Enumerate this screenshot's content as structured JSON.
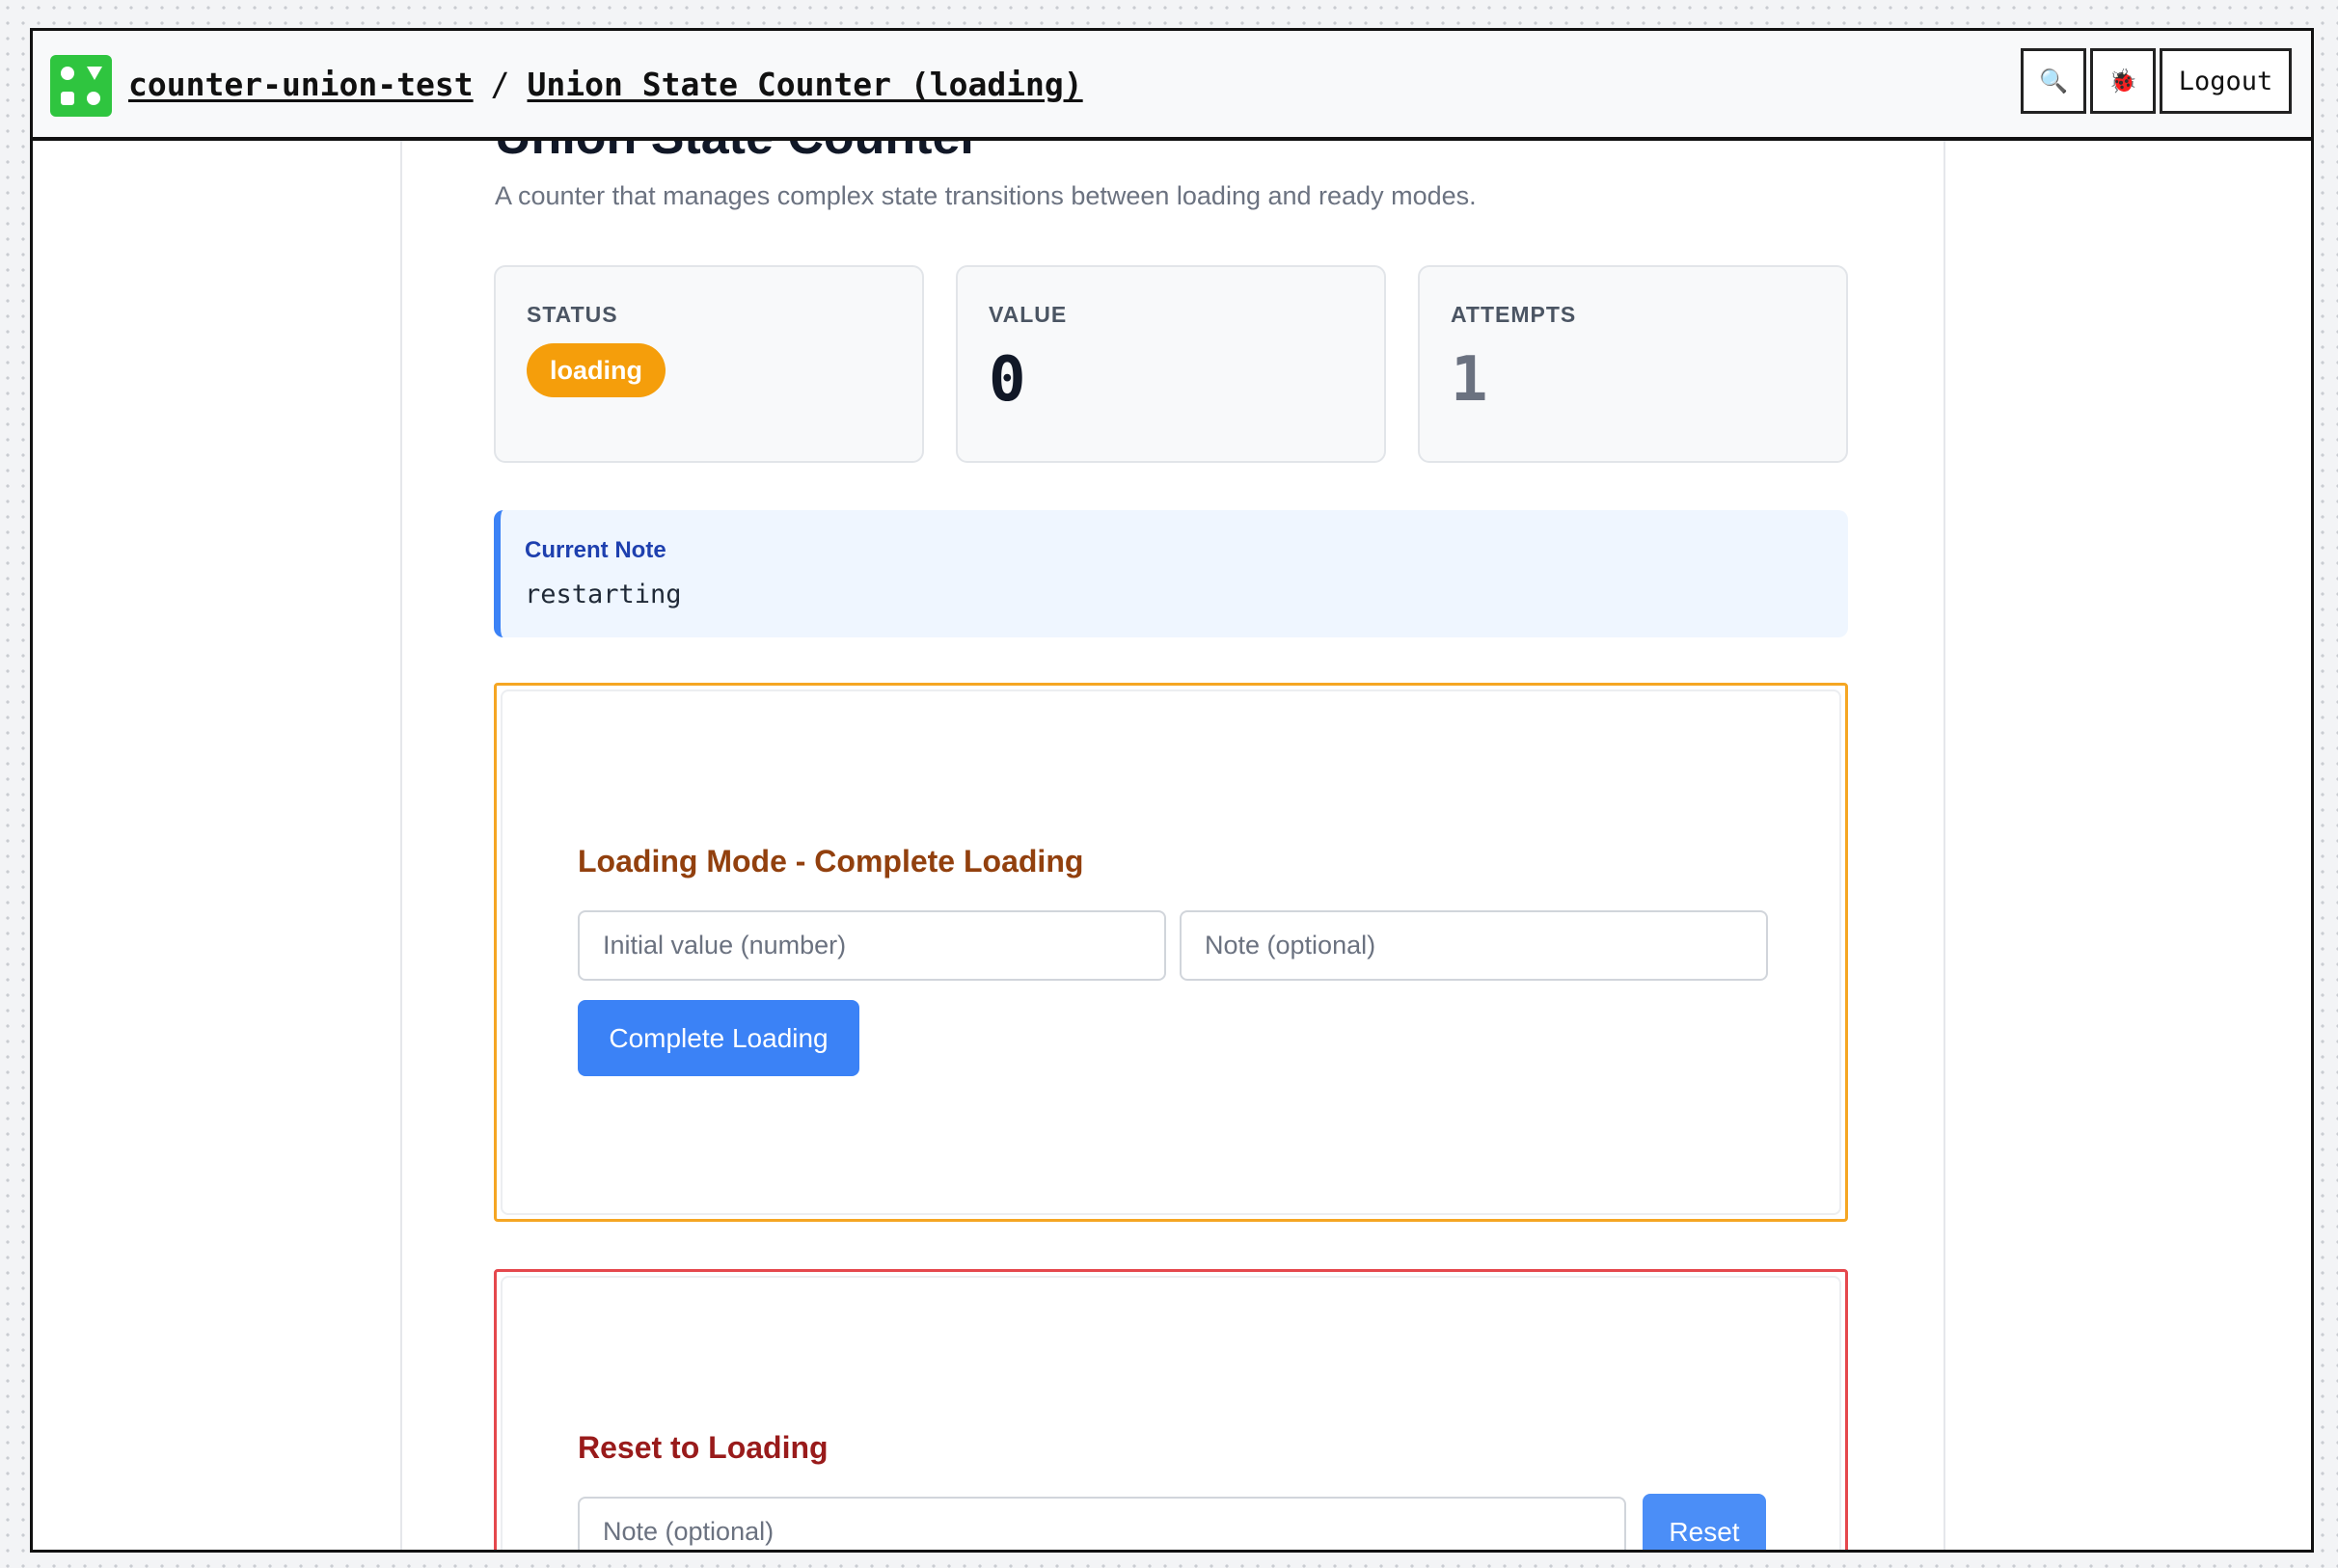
{
  "header": {
    "project": "counter-union-test",
    "separator": "/",
    "page": "Union State Counter (loading)",
    "search_icon": "🔍",
    "bug_icon": "🐞",
    "logout_label": "Logout"
  },
  "main": {
    "title": "Union State Counter",
    "description": "A counter that manages complex state transitions between loading and ready modes."
  },
  "stats": {
    "status_label": "STATUS",
    "status_value": "loading",
    "value_label": "VALUE",
    "value": "0",
    "attempts_label": "ATTEMPTS",
    "attempts": "1"
  },
  "note": {
    "label": "Current Note",
    "text": "restarting"
  },
  "loading_panel": {
    "title": "Loading Mode - Complete Loading",
    "initial_placeholder": "Initial value (number)",
    "note_placeholder": "Note (optional)",
    "button_label": "Complete Loading"
  },
  "reset_panel": {
    "title": "Reset to Loading",
    "note_placeholder": "Note (optional)",
    "button_label": "Reset"
  },
  "colors": {
    "logo": "#2fc53f",
    "status_badge": "#f59e0b",
    "note_accent": "#3b82f6",
    "loading_border": "#f5a623",
    "loading_title": "#92400e",
    "reset_border": "#e5484d",
    "reset_title": "#991b1b",
    "primary_button": "#3b82f6",
    "reset_button": "#4b8ef7"
  }
}
